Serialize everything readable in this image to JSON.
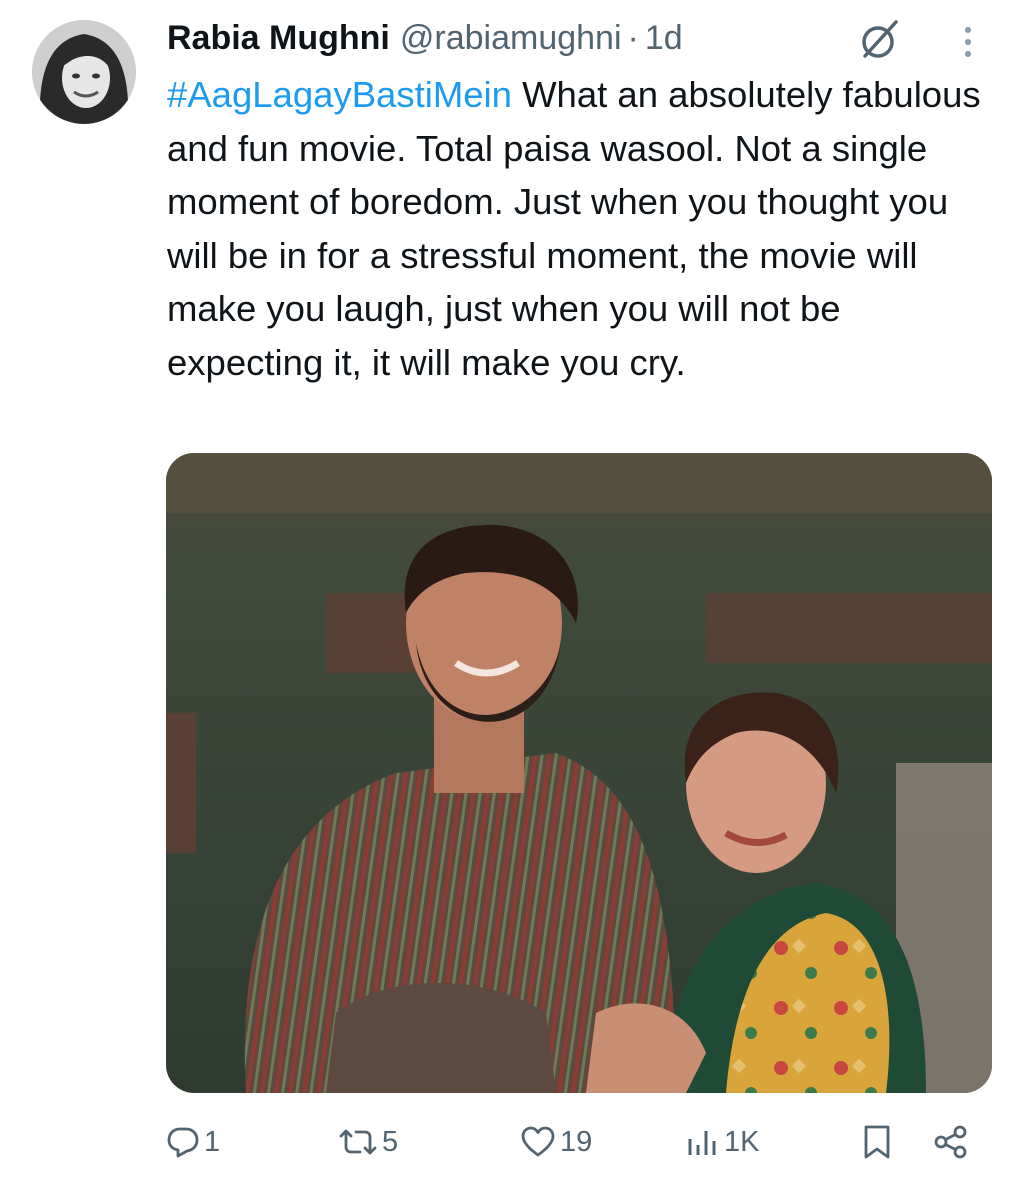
{
  "author": {
    "name": "Rabia Mughni",
    "handle": "@rabiamughni",
    "separator": "·",
    "time": "1d"
  },
  "tweet": {
    "hashtag": "#AagLagayBastiMein",
    "body": " What an absolutely fabulous and fun movie. Total paisa wasool. Not a single moment of boredom. Just when you thought you will be in for a stressful moment, the movie will make you laugh, just when you will not be expecting it, it will make you cry."
  },
  "actions": {
    "replies": "1",
    "reposts": "5",
    "likes": "19",
    "views": "1K"
  },
  "icons": {
    "grok": "grok-icon",
    "more": "more-vertical-icon",
    "reply": "reply-icon",
    "repost": "repost-icon",
    "like": "heart-icon",
    "views": "views-icon",
    "bookmark": "bookmark-icon",
    "share": "share-icon"
  },
  "colors": {
    "link": "#1d9bf0",
    "secondary_text": "#536471",
    "primary_text": "#0f1419"
  }
}
